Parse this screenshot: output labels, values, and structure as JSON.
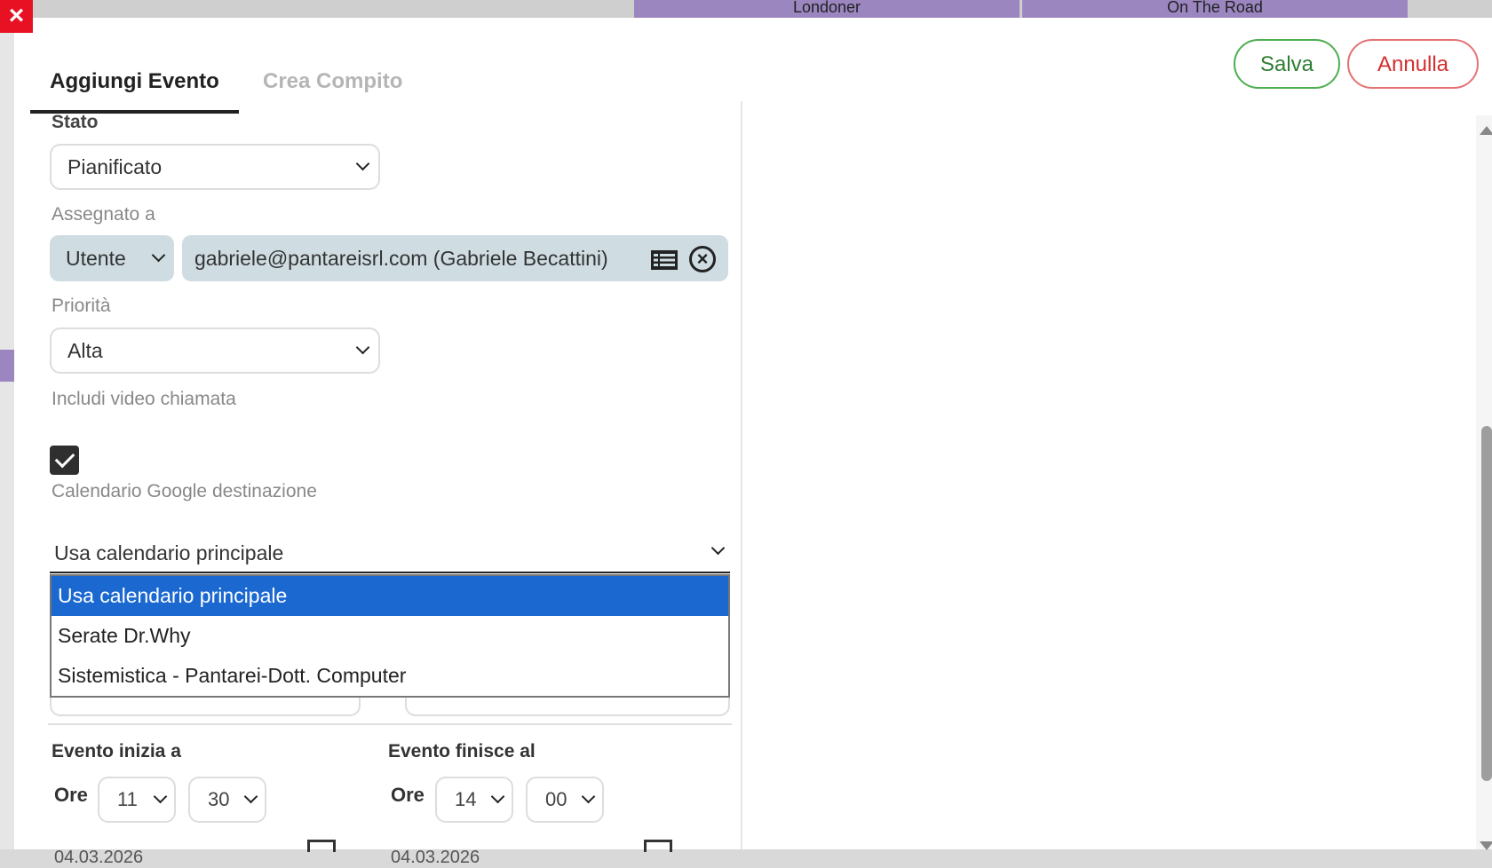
{
  "background": {
    "cells": [
      "Londoner",
      "On The Road"
    ]
  },
  "close_icon": "×",
  "tabs": [
    {
      "label": "Aggiungi Evento",
      "active": true
    },
    {
      "label": "Crea Compito",
      "active": false
    }
  ],
  "actions": {
    "save_label": "Salva",
    "cancel_label": "Annulla"
  },
  "form": {
    "status": {
      "label": "Stato",
      "value": "Pianificato"
    },
    "assigned": {
      "label": "Assegnato a",
      "type": "Utente",
      "value": "gabriele@pantareisrl.com (Gabriele Becattini)"
    },
    "priority": {
      "label": "Priorità",
      "value": "Alta"
    },
    "video_call": {
      "label": "Includi video chiamata",
      "checked": true
    },
    "google_calendar": {
      "label": "Calendario Google destinazione",
      "value": "Usa calendario principale",
      "options": [
        "Usa calendario principale",
        "Serate Dr.Why",
        "Sistemistica - Pantarei-Dott. Computer"
      ],
      "selected_index": 0
    },
    "start": {
      "label": "Evento inizia a",
      "hour_label": "Ore",
      "hour": "11",
      "minute": "30",
      "date": "04.03.2026"
    },
    "end": {
      "label": "Evento finisce al",
      "hour_label": "Ore",
      "hour": "14",
      "minute": "00",
      "date": "04.03.2026"
    }
  }
}
